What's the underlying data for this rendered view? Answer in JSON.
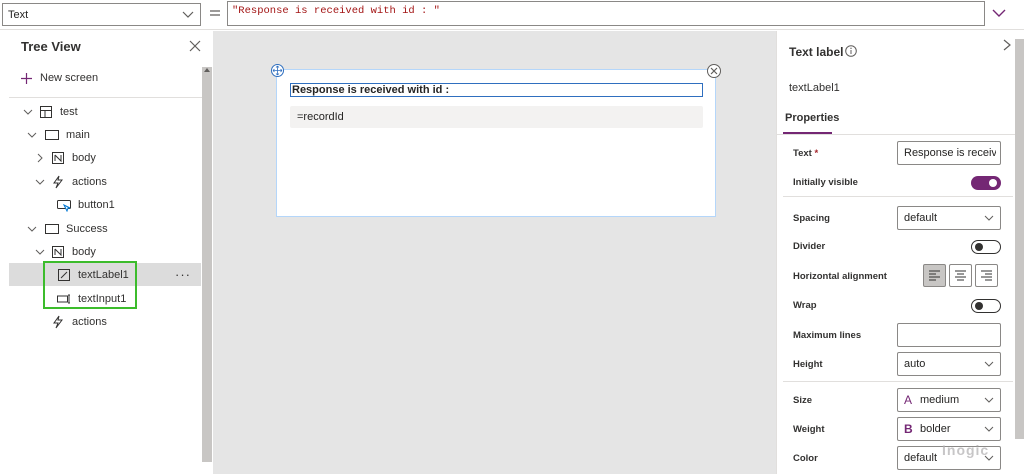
{
  "formula_bar": {
    "property": "Text",
    "formula": "\"Response is received with id : \""
  },
  "tree_view": {
    "title": "Tree View",
    "new_screen": "New screen",
    "items": [
      {
        "label": "test",
        "icon": "app-icon"
      },
      {
        "label": "main",
        "icon": "screen-icon"
      },
      {
        "label": "body",
        "icon": "container-icon"
      },
      {
        "label": "actions",
        "icon": "actions-icon"
      },
      {
        "label": "button1",
        "icon": "button-icon"
      },
      {
        "label": "Success",
        "icon": "screen-icon"
      },
      {
        "label": "body",
        "icon": "container-icon"
      },
      {
        "label": "textLabel1",
        "icon": "label-icon",
        "selected": true
      },
      {
        "label": "textInput1",
        "icon": "input-icon"
      },
      {
        "label": "actions",
        "icon": "actions-icon"
      }
    ],
    "more": "···",
    "highlight_color": "#3cbc2c"
  },
  "canvas": {
    "label_text": "Response is received with id :",
    "input_text": "=recordId"
  },
  "properties": {
    "title": "Text label",
    "control_name": "textLabel1",
    "tab": "Properties",
    "accent": "#742774",
    "text_label": "Text",
    "text_required": "*",
    "text_value": "Response is receiv...",
    "visible_label": "Initially visible",
    "visible_on": true,
    "spacing_label": "Spacing",
    "spacing_value": "default",
    "divider_label": "Divider",
    "divider_on": false,
    "halign_label": "Horizontal alignment",
    "halign_selected": "left",
    "wrap_label": "Wrap",
    "wrap_on": false,
    "maxlines_label": "Maximum lines",
    "maxlines_value": "",
    "height_label": "Height",
    "height_value": "auto",
    "size_label": "Size",
    "size_prefix": "A",
    "size_value": "medium",
    "weight_label": "Weight",
    "weight_prefix": "B",
    "weight_value": "bolder",
    "color_label": "Color",
    "color_value": "default"
  },
  "watermark": "Inogic"
}
